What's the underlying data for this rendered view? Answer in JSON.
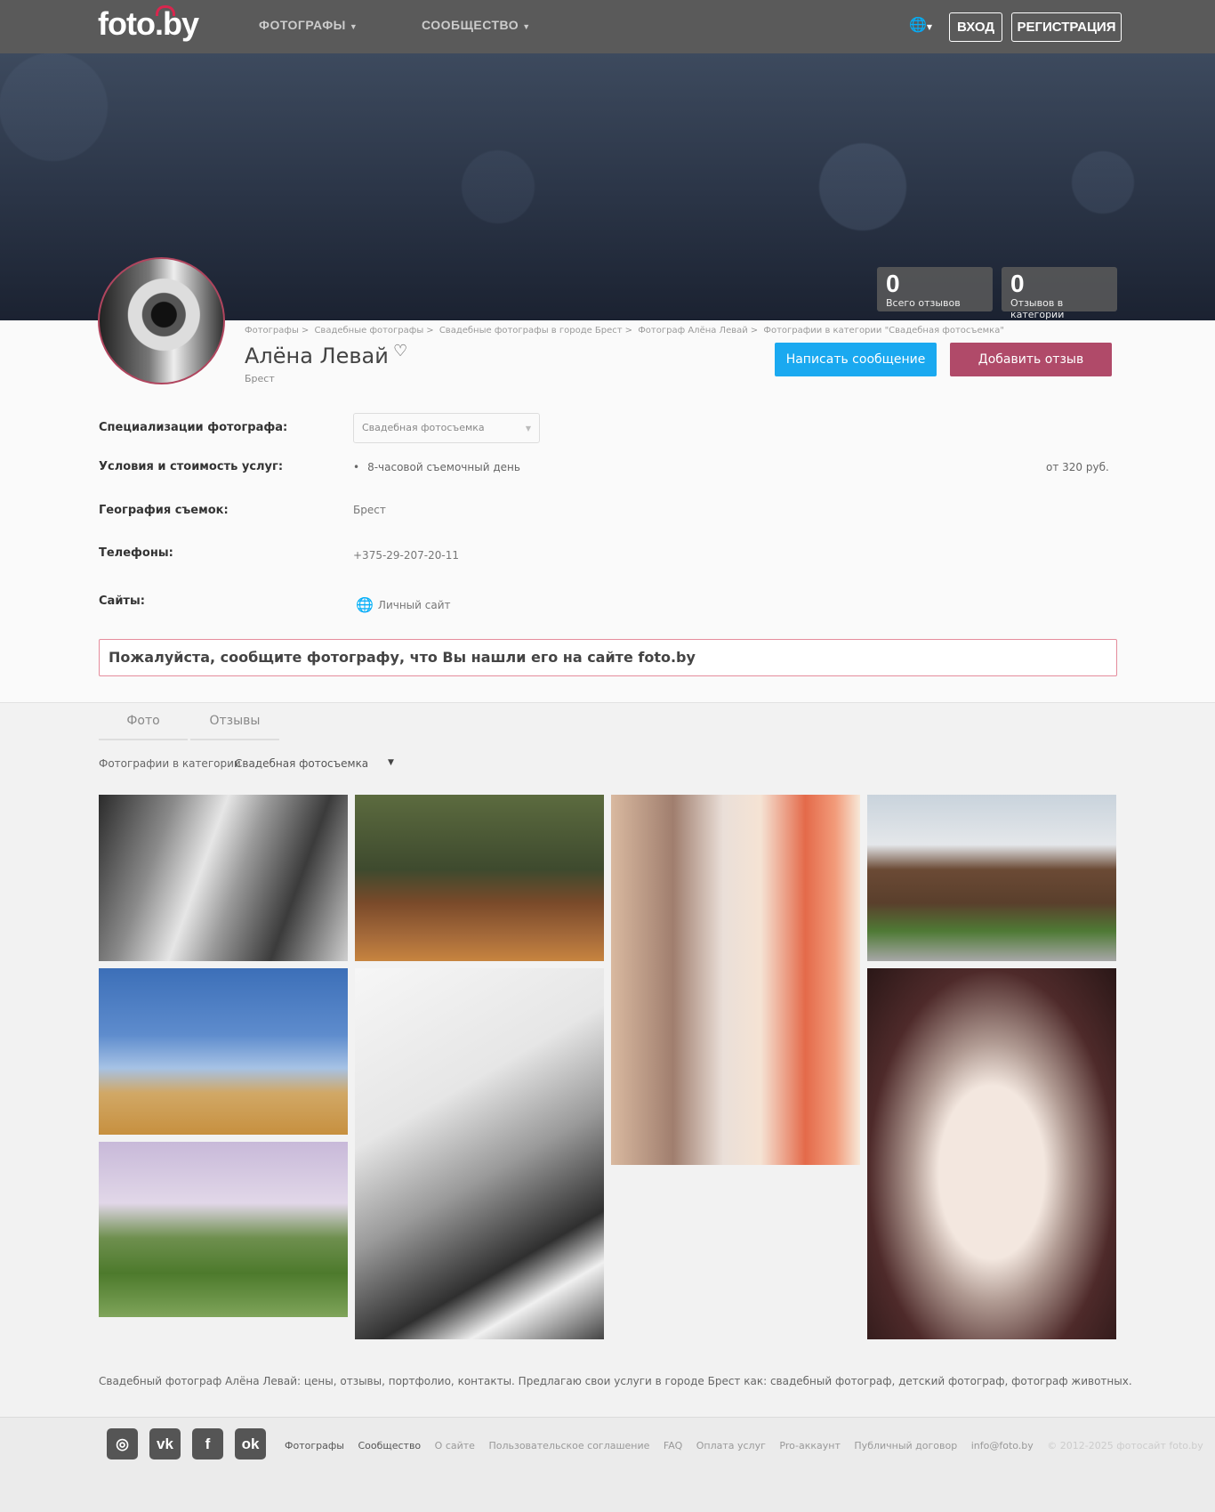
{
  "header": {
    "logo": "foto.by",
    "nav": [
      "ФОТОГРАФЫ",
      "СООБЩЕСТВО"
    ],
    "login": "ВХОД",
    "register": "РЕГИСТРАЦИЯ"
  },
  "stats": [
    {
      "value": "0",
      "label": "Всего отзывов"
    },
    {
      "value": "0",
      "label": "Отзывов в категории"
    }
  ],
  "breadcrumb": [
    "Фотографы",
    "Свадебные фотографы",
    "Свадебные фотографы в городе Брест",
    "Фотограф Алёна Левай",
    "Фотографии в категории \"Свадебная фотосъемка\""
  ],
  "profile": {
    "name": "Алёна Левай",
    "city": "Брест",
    "write_message": "Написать сообщение",
    "add_review": "Добавить отзыв"
  },
  "info": {
    "spec_label": "Специализации фотографа:",
    "spec_value": "Свадебная фотосъемка",
    "services_label": "Условия и стоимость услуг:",
    "service_name": "8-часовой съемочный день",
    "service_price": "от 320 руб.",
    "geo_label": "География съемок:",
    "geo_value": "Брест",
    "phones_label": "Телефоны:",
    "phone": "+375-29-207-20-11",
    "sites_label": "Сайты:",
    "site_link": "Личный сайт"
  },
  "notice": "Пожалуйста, сообщите фотографу, что Вы нашли его на сайте foto.by",
  "tabs": [
    "Фото",
    "Отзывы"
  ],
  "filter": {
    "label": "Фотографии в категории",
    "value": "Свадебная фотосъемка"
  },
  "description": "Свадебный фотограф Алёна Левай: цены, отзывы, портфолио, контакты. Предлагаю свои услуги в городе Брест как: свадебный фотограф, детский фотограф, фотограф животных.",
  "footer": {
    "links": [
      "Фотографы",
      "Сообщество",
      "О сайте",
      "Пользовательское соглашение",
      "FAQ",
      "Оплата услуг",
      "Pro-аккаунт",
      "Публичный договор",
      "info@foto.by"
    ],
    "copyright": "© 2012-2025 фотосайт foto.by",
    "social": [
      "instagram-icon",
      "vk-icon",
      "facebook-icon",
      "odnoklassniki-icon"
    ]
  },
  "colors": {
    "accent_blue": "#1aa9f0",
    "accent_pink": "#b04a69",
    "topbar": "#5a5a5a"
  }
}
